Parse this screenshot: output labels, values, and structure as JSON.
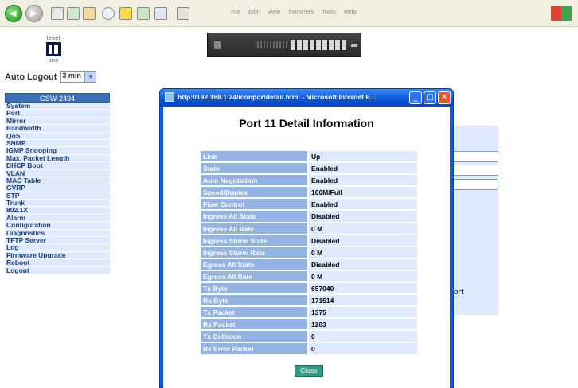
{
  "browser": {
    "menu": [
      "File",
      "Edit",
      "View",
      "Favorites",
      "Tools",
      "Help"
    ]
  },
  "logo": {
    "top": "level",
    "bottom": "one"
  },
  "auto_logout": {
    "label": "Auto Logout",
    "value": "3 min"
  },
  "sidebar": {
    "header": "GSW-2494",
    "items": [
      "System",
      "Port",
      "Mirror",
      "Bandwidth",
      "QoS",
      "SNMP",
      "IGMP Snooping",
      "Max. Packet Length",
      "DHCP Boot",
      "VLAN",
      "MAC Table",
      "GVRP",
      "STP",
      "Trunk",
      "802.1X",
      "Alarm",
      "Configuration",
      "Diagnostics",
      "TFTP Server",
      "Log",
      "Firmware Upgrade",
      "Reboot",
      "Logout"
    ]
  },
  "background_page": {
    "partial_text": "ort"
  },
  "popup": {
    "title": "http://192.168.1.24/iconportdetail.html - Microsoft Internet E...",
    "heading": "Port 11 Detail Information",
    "rows": [
      {
        "label": "Link",
        "value": "Up"
      },
      {
        "label": "State",
        "value": "Enabled"
      },
      {
        "label": "Auto Negotiation",
        "value": "Enabled"
      },
      {
        "label": "Speed/Duplex",
        "value": "100M/Full"
      },
      {
        "label": "Flow Control",
        "value": "Enabled"
      },
      {
        "label": "Ingress All State",
        "value": "Disabled"
      },
      {
        "label": "Ingress All Rate",
        "value": "0 M"
      },
      {
        "label": "Ingress Storm State",
        "value": "Disabled"
      },
      {
        "label": "Ingress Storm Rate",
        "value": "0 M"
      },
      {
        "label": "Egress All State",
        "value": "Disabled"
      },
      {
        "label": "Egress All Rate",
        "value": "0 M"
      },
      {
        "label": "Tx Byte",
        "value": "657040"
      },
      {
        "label": "Rx Byte",
        "value": "171514"
      },
      {
        "label": "Tx Packet",
        "value": "1375"
      },
      {
        "label": "Rx Packet",
        "value": "1283"
      },
      {
        "label": "Tx Collision",
        "value": "0"
      },
      {
        "label": "Rx Error Packet",
        "value": "0"
      }
    ],
    "close_label": "Close"
  }
}
